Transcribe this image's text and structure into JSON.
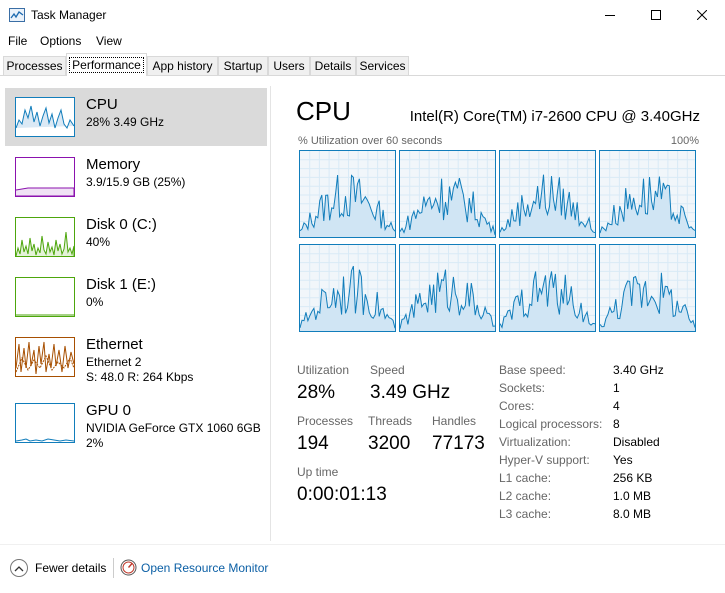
{
  "window": {
    "title": "Task Manager"
  },
  "menu": [
    "File",
    "Options",
    "View"
  ],
  "tabs": [
    "Processes",
    "Performance",
    "App history",
    "Startup",
    "Users",
    "Details",
    "Services"
  ],
  "active_tab": "Performance",
  "sidebar": [
    {
      "name": "CPU",
      "line1": "28% 3.49 GHz",
      "line2": "",
      "color": "#117dbb"
    },
    {
      "name": "Memory",
      "line1": "3.9/15.9 GB (25%)",
      "line2": "",
      "color": "#8b12ae"
    },
    {
      "name": "Disk 0 (C:)",
      "line1": "40%",
      "line2": "",
      "color": "#4da60c"
    },
    {
      "name": "Disk 1 (E:)",
      "line1": "0%",
      "line2": "",
      "color": "#4da60c"
    },
    {
      "name": "Ethernet",
      "line1": "Ethernet 2",
      "line2": "S: 48.0  R: 264 Kbps",
      "color": "#a74f01"
    },
    {
      "name": "GPU 0",
      "line1": "NVIDIA GeForce GTX 1060 6GB",
      "line2": "2%",
      "color": "#117dbb"
    }
  ],
  "main": {
    "title": "CPU",
    "model": "Intel(R) Core(TM) i7-2600 CPU @ 3.40GHz",
    "graph_label": "% Utilization over 60 seconds",
    "graph_max": "100%",
    "core_count_graphs": 8
  },
  "stats": {
    "utilization_label": "Utilization",
    "utilization": "28%",
    "speed_label": "Speed",
    "speed": "3.49 GHz",
    "processes_label": "Processes",
    "processes": "194",
    "threads_label": "Threads",
    "threads": "3200",
    "handles_label": "Handles",
    "handles": "77173",
    "uptime_label": "Up time",
    "uptime": "0:00:01:13"
  },
  "details": [
    {
      "label": "Base speed:",
      "value": "3.40 GHz"
    },
    {
      "label": "Sockets:",
      "value": "1"
    },
    {
      "label": "Cores:",
      "value": "4"
    },
    {
      "label": "Logical processors:",
      "value": "8"
    },
    {
      "label": "Virtualization:",
      "value": "Disabled"
    },
    {
      "label": "Hyper-V support:",
      "value": "Yes"
    },
    {
      "label": "L1 cache:",
      "value": "256 KB"
    },
    {
      "label": "L2 cache:",
      "value": "1.0 MB"
    },
    {
      "label": "L3 cache:",
      "value": "8.0 MB"
    }
  ],
  "footer": {
    "fewer_details": "Fewer details",
    "open_resource_monitor": "Open Resource Monitor"
  },
  "icons": {
    "app": "task-manager-icon",
    "minimize": "minimize-icon",
    "maximize": "maximize-icon",
    "close": "close-icon",
    "fewer": "chevron-up-icon",
    "resource_monitor": "resource-monitor-icon"
  }
}
